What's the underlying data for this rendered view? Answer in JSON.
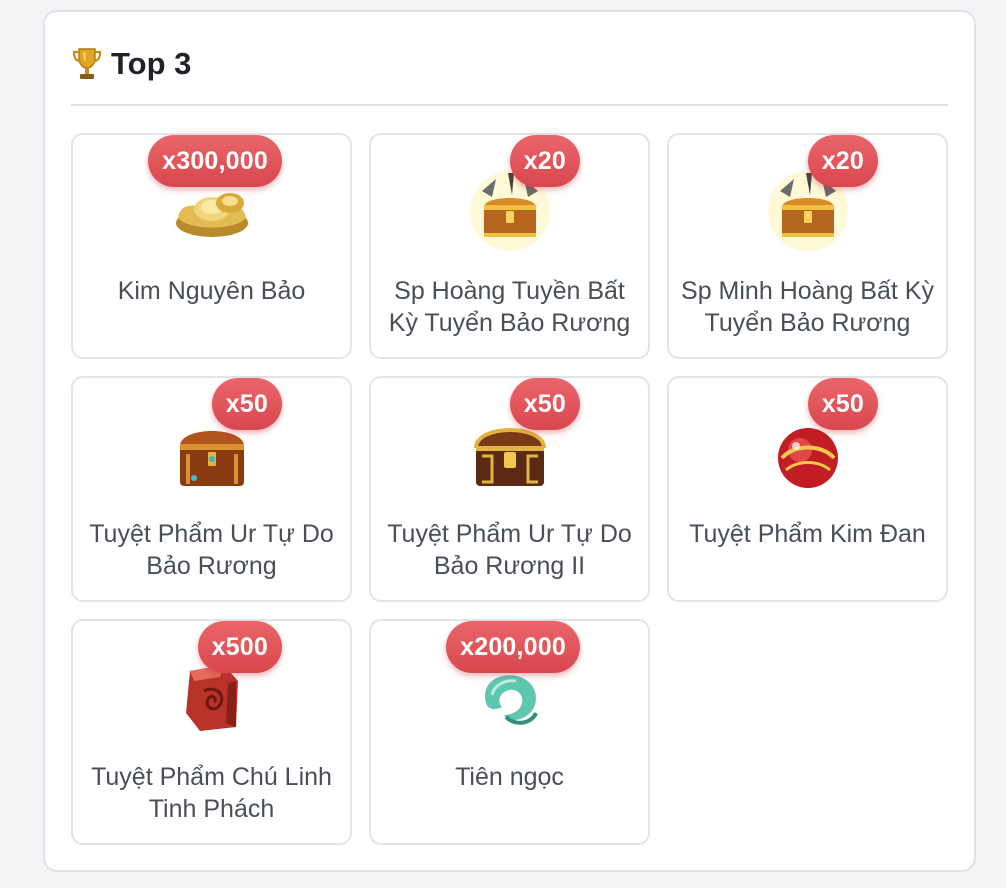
{
  "panel": {
    "title": "Top 3"
  },
  "items": [
    {
      "name": "Kim Nguyên Bảo",
      "qty": "x300,000",
      "icon": "gold-ingot-icon"
    },
    {
      "name": "Sp Hoàng Tuyền Bất Kỳ Tuyển Bảo Rương",
      "qty": "x20",
      "icon": "golden-chest-icon"
    },
    {
      "name": "Sp Minh Hoàng Bất Kỳ Tuyển Bảo Rương",
      "qty": "x20",
      "icon": "golden-chest-icon"
    },
    {
      "name": "Tuyệt Phẩm Ur Tự Do Bảo Rương",
      "qty": "x50",
      "icon": "bronze-chest-icon"
    },
    {
      "name": "Tuyệt Phẩm Ur Tự Do Bảo Rương II",
      "qty": "x50",
      "icon": "gold-chest-icon"
    },
    {
      "name": "Tuyệt Phẩm Kim Đan",
      "qty": "x50",
      "icon": "red-orb-icon"
    },
    {
      "name": "Tuyệt Phẩm Chú Linh Tinh Phách",
      "qty": "x500",
      "icon": "red-crystal-icon"
    },
    {
      "name": "Tiên ngọc",
      "qty": "x200,000",
      "icon": "jade-icon"
    }
  ]
}
